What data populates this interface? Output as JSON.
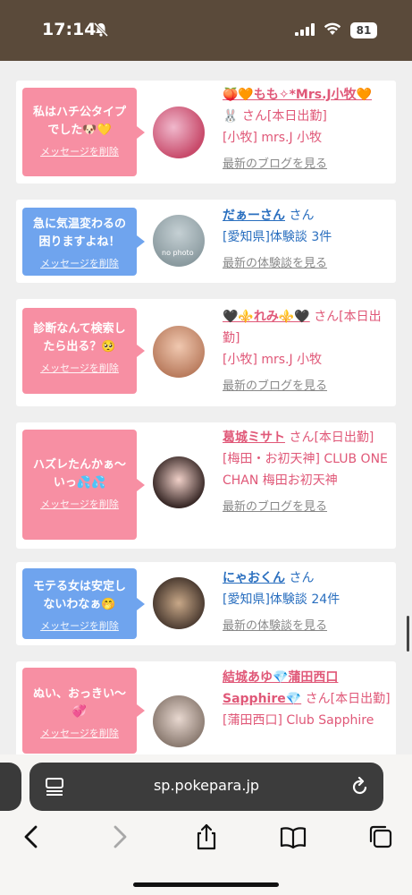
{
  "status_bar": {
    "time": "17:14",
    "battery": "81"
  },
  "cards": [
    {
      "bubble_color": "pink",
      "message": "私はハチ公タイプ\nでした🐶💛",
      "delete_label": "メッセージを削除",
      "name": "🍑🧡もも✧*Mrs.J小牧🧡",
      "name_line2": "🐰",
      "suffix": "さん[本日出勤]",
      "detail": "[小牧] mrs.J 小牧",
      "more": "最新のブログを見る",
      "name_color": "pink",
      "avatar_colors": [
        "#c84b6b",
        "#e8a0b8"
      ]
    },
    {
      "bubble_color": "blue",
      "message": "急に気温変わるの\n困りますよね！",
      "delete_label": "メッセージを削除",
      "name": "だぁーさん",
      "name_line2": "",
      "suffix": "さん",
      "detail": "[愛知県]体験談 3件",
      "more": "最新の体験談を見る",
      "name_color": "blue",
      "avatar_colors": [
        "#9aa8ae",
        "#c5d0d4"
      ],
      "avatar_label": "no photo"
    },
    {
      "bubble_color": "pink",
      "message": "診断なんて検索し\nたら出る？🥺",
      "delete_label": "メッセージを削除",
      "name": "🖤⚜️れみ⚜️🖤",
      "name_line2": "",
      "suffix": "さん[本日出勤]",
      "detail": "[小牧] mrs.J 小牧",
      "more": "最新のブログを見る",
      "name_color": "pink",
      "avatar_colors": [
        "#c98a6c",
        "#f0c8b0"
      ]
    },
    {
      "bubble_color": "pink",
      "message": "ハズレたんかぁ〜\nいっ💦💦",
      "delete_label": "メッセージを削除",
      "name": "葛城ミサト",
      "name_line2": "",
      "suffix": "さん[本日出勤]",
      "detail": "[梅田・お初天神] CLUB ONE CHAN 梅田お初天神",
      "more": "最新のブログを見る",
      "name_color": "pink",
      "avatar_colors": [
        "#3a2a28",
        "#e8c8c0"
      ]
    },
    {
      "bubble_color": "blue",
      "message": "モテる女は安定し\nないわなぁ🤭",
      "delete_label": "メッセージを削除",
      "name": "にゃおくん",
      "name_line2": "",
      "suffix": "さん",
      "detail": "[愛知県]体験談 24件",
      "more": "最新の体験談を見る",
      "name_color": "blue",
      "avatar_colors": [
        "#4a3a30",
        "#b89a80"
      ]
    },
    {
      "bubble_color": "pink",
      "message": "ぬい、おっきい〜\n💞",
      "delete_label": "メッセージを削除",
      "name": "結城あゆ💎蒲田西口Sapphire💎",
      "name_line2": "",
      "suffix": "さん[本日出勤]",
      "detail": "[蒲田西口] Club Sapphire",
      "more": "",
      "name_color": "pink",
      "avatar_colors": [
        "#8a7a70",
        "#e0d0c8"
      ]
    }
  ],
  "browser": {
    "url": "sp.pokepara.jp"
  }
}
